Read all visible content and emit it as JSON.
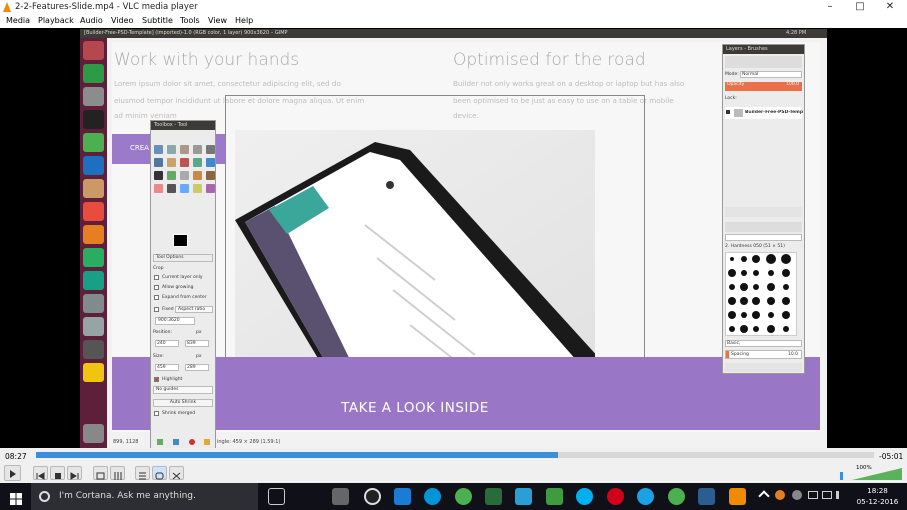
{
  "window": {
    "title": "2-2-Features-Slide.mp4 - VLC media player",
    "minimize": "–",
    "maximize": "□",
    "close": "✕"
  },
  "menu": [
    "Media",
    "Playback",
    "Audio",
    "Video",
    "Subtitle",
    "Tools",
    "View",
    "Help"
  ],
  "gimp": {
    "titlebar": "[Builder-Free-PSD-Template] (imported)-1.0 (RGB color, 1 layer) 900x3620 – GIMP",
    "tray_time": "4:28 PM",
    "status_left": "899, 1128",
    "status_right": "ingle: 459 × 289 (1.59:1)"
  },
  "canvas": {
    "heading_left": "Work with your hands",
    "para_left_1": "Lorem ipsum dolor sit amet, consectetur adipiscing elit, sed do",
    "para_left_2": "eiusmod tempor incididunt ut labore et dolore magna aliqua. Ut enim",
    "para_left_3": "ad minim veniam",
    "heading_right": "Optimised for the road",
    "para_right_1": "Builder not only works great on a desktop or laptop but has also",
    "para_right_2": "been optimised to be just as easy to use on a table or mobile",
    "para_right_3": "device.",
    "cta_partial": "CREA",
    "banner": "TAKE A LOOK INSIDE"
  },
  "toolbox": {
    "title": "Toolbox - Tool",
    "tool_options": "Tool Options",
    "crop": "Crop",
    "current_layer_only": "Current layer only",
    "allow_growing": "Allow growing",
    "expand_from_center": "Expand from center",
    "fixed": "Fixed",
    "aspect_ratio": "Aspect ratio",
    "ratio_value": "900:3620",
    "position": "Position:",
    "pos_x": "240",
    "pos_y": "839",
    "size": "Size:",
    "size_w": "459",
    "size_h": "289",
    "unit": "px",
    "highlight": "Highlight",
    "guides": "No guides",
    "auto_shrink": "Auto Shrink",
    "shrink_merged": "Shrink merged"
  },
  "layers": {
    "title": "Layers - Brushes",
    "mode_label": "Mode:",
    "mode_value": "Normal",
    "opacity_label": "Opacity",
    "opacity_value": "100.0",
    "lock_label": "Lock:",
    "layer_name": "Builder-Free-PSD-Temp",
    "brush_name": "2. Hardness 050 (51 × 51)",
    "brush_tag": "Basic,",
    "spacing_label": "Spacing",
    "spacing_value": "10.0"
  },
  "player": {
    "elapsed": "08:27",
    "remaining": "-05:01",
    "progress_fraction": 0.623,
    "volume": "100%"
  },
  "taskbar": {
    "cortana": "I'm Cortana. Ask me anything.",
    "time": "18:28",
    "date": "05-12-2016"
  },
  "colors": {
    "accent_purple": "#9977c6",
    "vlc_seek": "#3b8ed8",
    "ubuntu_launcher": "#5d1f3a",
    "vlc_orange": "#f08a00"
  }
}
